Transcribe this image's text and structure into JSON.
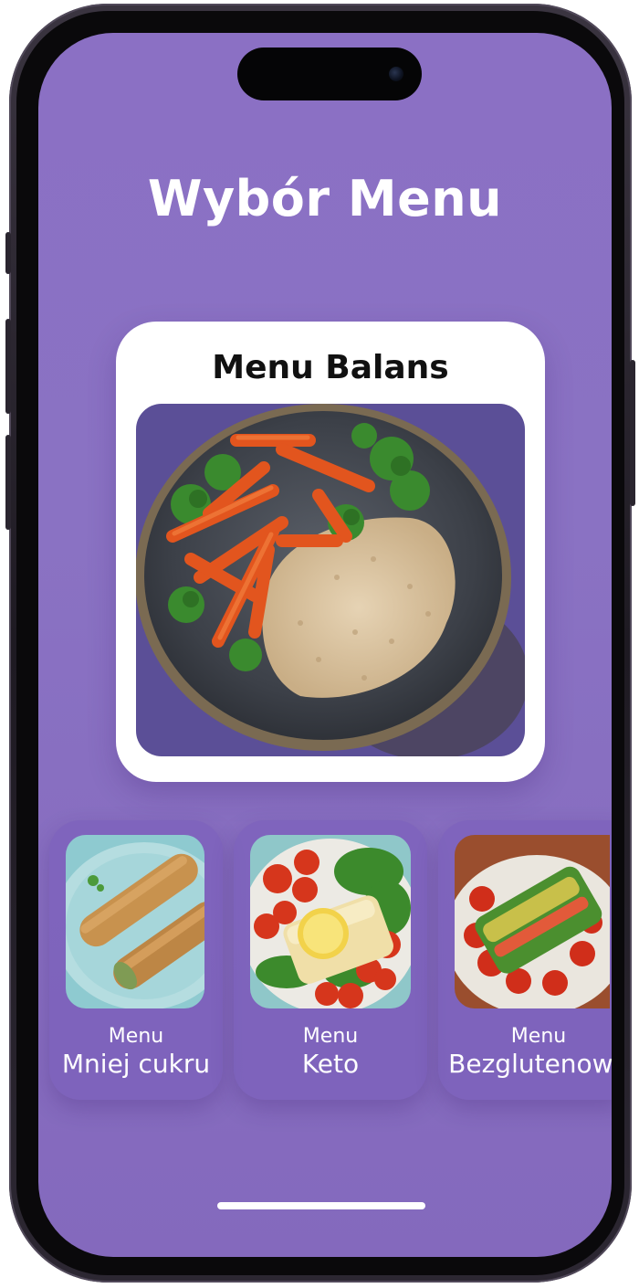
{
  "screen": {
    "title": "Wybór Menu"
  },
  "featured": {
    "title": "Menu Balans",
    "image_desc": "rice-carrot-broccoli-bowl"
  },
  "menus": [
    {
      "prefix": "Menu",
      "name": "Mniej cukru"
    },
    {
      "prefix": "Menu",
      "name": "Keto"
    },
    {
      "prefix": "Menu",
      "name": "Bezglutenowe"
    }
  ],
  "colors": {
    "background": "#8a72c3",
    "card": "#ffffff",
    "text_light": "#ffffff",
    "text_dark": "#111111"
  }
}
